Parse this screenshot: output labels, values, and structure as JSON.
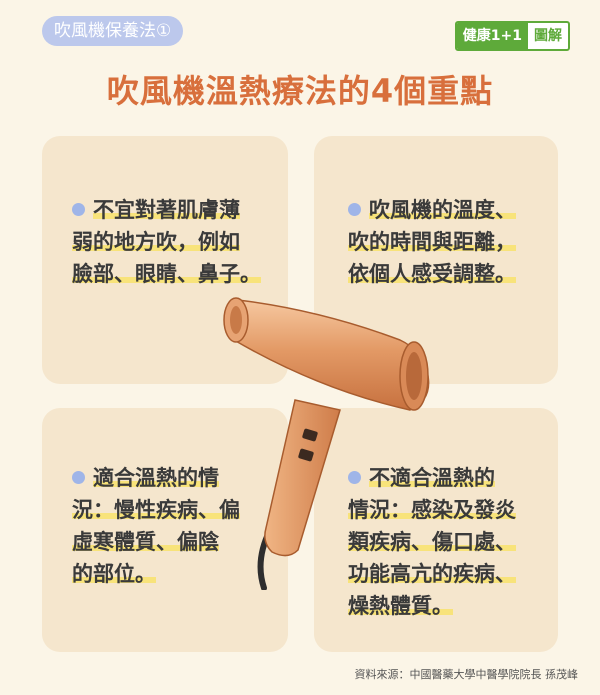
{
  "tag": "吹風機保養法①",
  "brand": {
    "part1": "健康1+1",
    "part2": "圖解"
  },
  "title": "吹風機溫熱療法的4個重點",
  "cards": [
    {
      "lines": [
        "不宜對著肌膚薄",
        "弱的地方吹，例如",
        "臉部、眼睛、鼻子。"
      ]
    },
    {
      "lines": [
        "吹風機的溫度、",
        "吹的時間與距離，",
        "依個人感受調整。"
      ]
    },
    {
      "lines": [
        "適合溫熱的情",
        "況：慢性疾病、偏",
        "虛寒體質、偏陰",
        "的部位。"
      ]
    },
    {
      "lines": [
        "不適合溫熱的",
        "情況：感染及發炎",
        "類疾病、傷口處、",
        "功能高亢的疾病、",
        "燥熱體質。"
      ]
    }
  ],
  "source": "資料來源：中國醫藥大學中醫學院院長 孫茂峰",
  "colors": {
    "accent": "#d86f3c",
    "card": "#f5e6cd",
    "highlight": "#f8e37a",
    "dot": "#9fb5e8",
    "brand": "#5eaa3a"
  }
}
